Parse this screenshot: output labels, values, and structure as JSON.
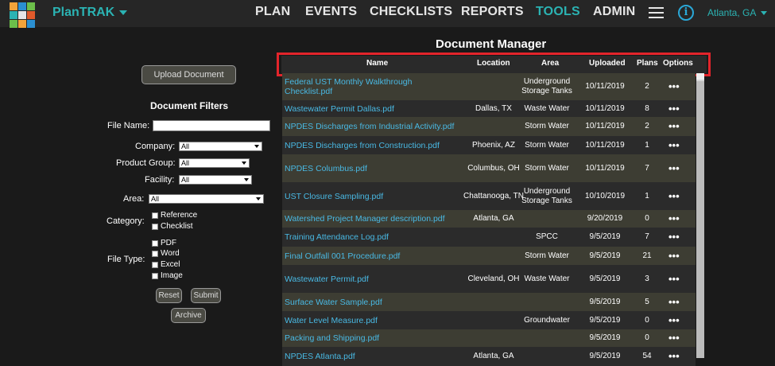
{
  "nav": {
    "brand": "PlanTRAK",
    "items": [
      "PLAN",
      "EVENTS",
      "CHECKLISTS",
      "REPORTS",
      "TOOLS",
      "ADMIN"
    ],
    "active": "TOOLS",
    "location": "Atlanta, GA"
  },
  "filters": {
    "upload_label": "Upload Document",
    "title": "Document Filters",
    "file_name_label": "File Name:",
    "file_name_value": "",
    "company_label": "Company:",
    "company_value": "All",
    "product_group_label": "Product Group:",
    "product_group_value": "All",
    "facility_label": "Facility:",
    "facility_value": "All",
    "area_label": "Area:",
    "area_value": "All",
    "category_label": "Category:",
    "category_options": [
      "Reference",
      "Checklist"
    ],
    "file_type_label": "File Type:",
    "file_type_options": [
      "PDF",
      "Word",
      "Excel",
      "Image"
    ],
    "reset_label": "Reset",
    "submit_label": "Submit",
    "archive_label": "Archive"
  },
  "manager": {
    "title": "Document Manager",
    "columns": [
      "Name",
      "Location",
      "Area",
      "Uploaded",
      "Plans",
      "Options"
    ],
    "options_glyph": "•••",
    "rows": [
      {
        "name": "Federal UST Monthly Walkthrough Checklist.pdf",
        "location": "",
        "area": "Underground Storage Tanks",
        "uploaded": "10/11/2019",
        "plans": "2"
      },
      {
        "name": "Wastewater Permit Dallas.pdf",
        "location": "Dallas, TX",
        "area": "Waste Water",
        "uploaded": "10/11/2019",
        "plans": "8"
      },
      {
        "name": "NPDES Discharges from Industrial Activity.pdf",
        "location": "",
        "area": "Storm Water",
        "uploaded": "10/11/2019",
        "plans": "2"
      },
      {
        "name": "NPDES Discharges from Construction.pdf",
        "location": "Phoenix, AZ",
        "area": "Storm Water",
        "uploaded": "10/11/2019",
        "plans": "1"
      },
      {
        "name": "NPDES Columbus.pdf",
        "location": "Columbus, OH",
        "area": "Storm Water",
        "uploaded": "10/11/2019",
        "plans": "7"
      },
      {
        "name": "UST Closure Sampling.pdf",
        "location": "Chattanooga, TN",
        "area": "Underground Storage Tanks",
        "uploaded": "10/10/2019",
        "plans": "1"
      },
      {
        "name": "Watershed Project Manager description.pdf",
        "location": "Atlanta, GA",
        "area": "",
        "uploaded": "9/20/2019",
        "plans": "0"
      },
      {
        "name": "Training Attendance Log.pdf",
        "location": "",
        "area": "SPCC",
        "uploaded": "9/5/2019",
        "plans": "7"
      },
      {
        "name": "Final Outfall 001 Procedure.pdf",
        "location": "",
        "area": "Storm Water",
        "uploaded": "9/5/2019",
        "plans": "21"
      },
      {
        "name": "Wastewater Permit.pdf",
        "location": "Cleveland, OH",
        "area": "Waste Water",
        "uploaded": "9/5/2019",
        "plans": "3"
      },
      {
        "name": "Surface Water Sample.pdf",
        "location": "",
        "area": "",
        "uploaded": "9/5/2019",
        "plans": "5"
      },
      {
        "name": "Water Level Measure.pdf",
        "location": "",
        "area": "Groundwater",
        "uploaded": "9/5/2019",
        "plans": "0"
      },
      {
        "name": "Packing and Shipping.pdf",
        "location": "",
        "area": "",
        "uploaded": "9/5/2019",
        "plans": "0"
      },
      {
        "name": "NPDES Atlanta.pdf",
        "location": "Atlanta, GA",
        "area": "",
        "uploaded": "9/5/2019",
        "plans": "54"
      }
    ]
  },
  "colors": {
    "accent": "#2bb3b3",
    "link": "#49b9e4",
    "highlight": "#e3242b"
  }
}
